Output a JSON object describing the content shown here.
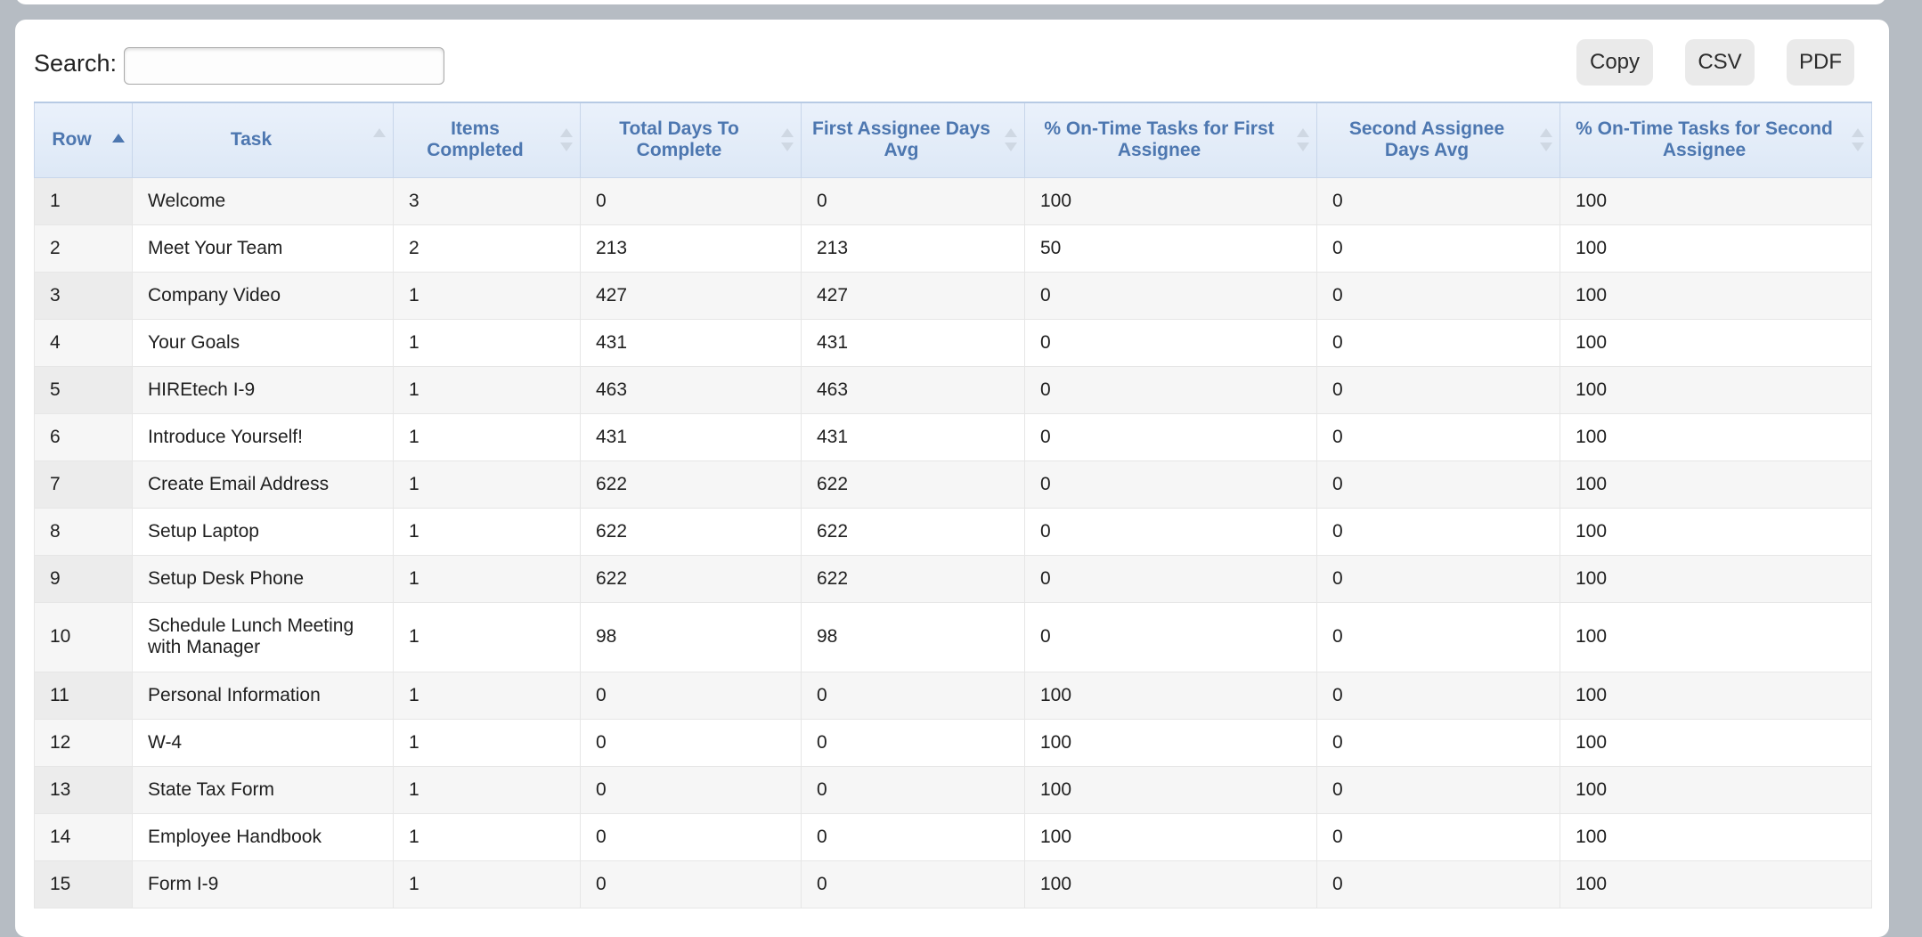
{
  "search": {
    "label": "Search:",
    "value": ""
  },
  "buttons": {
    "copy": "Copy",
    "csv": "CSV",
    "pdf": "PDF"
  },
  "columns": [
    "Row",
    "Task",
    "Items Completed",
    "Total Days To Complete",
    "First Assignee Days Avg",
    "% On-Time Tasks for First Assignee",
    "Second Assignee Days Avg",
    "% On-Time Tasks for Second Assignee"
  ],
  "rows": [
    [
      "1",
      "Welcome",
      "3",
      "0",
      "0",
      "100",
      "0",
      "100"
    ],
    [
      "2",
      "Meet Your Team",
      "2",
      "213",
      "213",
      "50",
      "0",
      "100"
    ],
    [
      "3",
      "Company Video",
      "1",
      "427",
      "427",
      "0",
      "0",
      "100"
    ],
    [
      "4",
      "Your Goals",
      "1",
      "431",
      "431",
      "0",
      "0",
      "100"
    ],
    [
      "5",
      "HIREtech I-9",
      "1",
      "463",
      "463",
      "0",
      "0",
      "100"
    ],
    [
      "6",
      "Introduce Yourself!",
      "1",
      "431",
      "431",
      "0",
      "0",
      "100"
    ],
    [
      "7",
      "Create Email Address",
      "1",
      "622",
      "622",
      "0",
      "0",
      "100"
    ],
    [
      "8",
      "Setup Laptop",
      "1",
      "622",
      "622",
      "0",
      "0",
      "100"
    ],
    [
      "9",
      "Setup Desk Phone",
      "1",
      "622",
      "622",
      "0",
      "0",
      "100"
    ],
    [
      "10",
      "Schedule Lunch Meeting with Manager",
      "1",
      "98",
      "98",
      "0",
      "0",
      "100"
    ],
    [
      "11",
      "Personal Information",
      "1",
      "0",
      "0",
      "100",
      "0",
      "100"
    ],
    [
      "12",
      "W-4",
      "1",
      "0",
      "0",
      "100",
      "0",
      "100"
    ],
    [
      "13",
      "State Tax Form",
      "1",
      "0",
      "0",
      "100",
      "0",
      "100"
    ],
    [
      "14",
      "Employee Handbook",
      "1",
      "0",
      "0",
      "100",
      "0",
      "100"
    ],
    [
      "15",
      "Form I-9",
      "1",
      "0",
      "0",
      "100",
      "0",
      "100"
    ]
  ]
}
